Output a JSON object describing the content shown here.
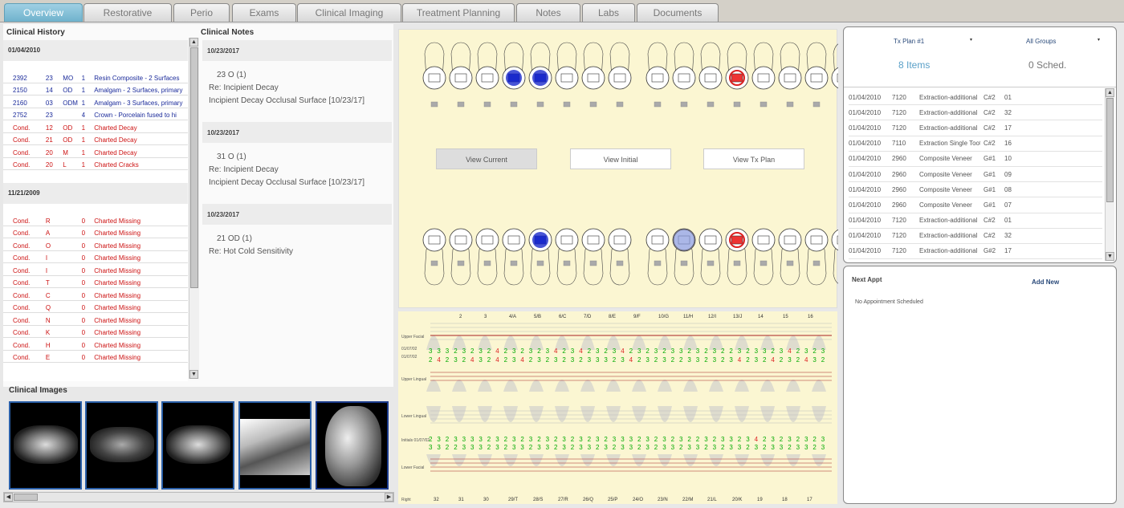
{
  "tabs": [
    "Overview",
    "Restorative",
    "Perio",
    "Exams",
    "Clinical Imaging",
    "Treatment Planning",
    "Notes",
    "Labs",
    "Documents"
  ],
  "clinical_history": {
    "title": "Clinical History",
    "groups": [
      {
        "date": "01/04/2010",
        "rows": [
          {
            "c": "blue",
            "f": [
              "2392",
              "23",
              "MO",
              "1",
              "Resin Composite - 2 Surfaces"
            ]
          },
          {
            "c": "blue",
            "f": [
              "2150",
              "14",
              "OD",
              "1",
              "Amalgam - 2 Surfaces, primary"
            ]
          },
          {
            "c": "blue",
            "f": [
              "2160",
              "03",
              "ODM",
              "1",
              "Amalgam - 3 Surfaces, primary"
            ]
          },
          {
            "c": "blue",
            "f": [
              "2752",
              "23",
              "",
              "4",
              "Crown - Porcelain fused to hi"
            ]
          },
          {
            "c": "red",
            "f": [
              "Cond.",
              "12",
              "OD",
              "1",
              "Charted Decay"
            ]
          },
          {
            "c": "red",
            "f": [
              "Cond.",
              "21",
              "OD",
              "1",
              "Charted Decay"
            ]
          },
          {
            "c": "red",
            "f": [
              "Cond.",
              "20",
              "M",
              "1",
              "Charted Decay"
            ]
          },
          {
            "c": "red",
            "f": [
              "Cond.",
              "20",
              "L",
              "1",
              "Charted Cracks"
            ]
          }
        ]
      },
      {
        "date": "11/21/2009",
        "rows": [
          {
            "c": "red",
            "f": [
              "Cond.",
              "R",
              "",
              "0",
              "Charted Missing"
            ]
          },
          {
            "c": "red",
            "f": [
              "Cond.",
              "A",
              "",
              "0",
              "Charted Missing"
            ]
          },
          {
            "c": "red",
            "f": [
              "Cond.",
              "O",
              "",
              "0",
              "Charted Missing"
            ]
          },
          {
            "c": "red",
            "f": [
              "Cond.",
              "I",
              "",
              "0",
              "Charted Missing"
            ]
          },
          {
            "c": "red",
            "f": [
              "Cond.",
              "I",
              "",
              "0",
              "Charted Missing"
            ]
          },
          {
            "c": "red",
            "f": [
              "Cond.",
              "T",
              "",
              "0",
              "Charted Missing"
            ]
          },
          {
            "c": "red",
            "f": [
              "Cond.",
              "C",
              "",
              "0",
              "Charted Missing"
            ]
          },
          {
            "c": "red",
            "f": [
              "Cond.",
              "Q",
              "",
              "0",
              "Charted Missing"
            ]
          },
          {
            "c": "red",
            "f": [
              "Cond.",
              "N",
              "",
              "0",
              "Charted Missing"
            ]
          },
          {
            "c": "red",
            "f": [
              "Cond.",
              "K",
              "",
              "0",
              "Charted Missing"
            ]
          },
          {
            "c": "red",
            "f": [
              "Cond.",
              "H",
              "",
              "0",
              "Charted Missing"
            ]
          },
          {
            "c": "red",
            "f": [
              "Cond.",
              "E",
              "",
              "0",
              "Charted Missing"
            ]
          }
        ]
      }
    ]
  },
  "clinical_notes": {
    "title": "Clinical Notes",
    "notes": [
      {
        "date": "10/23/2017",
        "lines": [
          "23   O   (1)",
          "Re: Incipient Decay",
          "Incipient Decay Occlusal Surface [10/23/17]"
        ]
      },
      {
        "date": "10/23/2017",
        "lines": [
          "31   O   (1)",
          "Re: Incipient Decay",
          "Incipient Decay Occlusal Surface [10/23/17]"
        ]
      },
      {
        "date": "10/23/2017",
        "lines": [
          "21   OD   (1)",
          "Re: Hot  Cold Sensitivity"
        ]
      }
    ]
  },
  "clinical_images": {
    "title": "Clinical Images"
  },
  "chart_buttons": [
    "View Current",
    "View Initial",
    "View Tx Plan"
  ],
  "perio": {
    "upper_teeth": [
      "2",
      "3",
      "4/A",
      "5/B",
      "6/C",
      "7/D",
      "8/E",
      "9/F",
      "10/G",
      "11/H",
      "12/I",
      "13/J",
      "14",
      "15",
      "16"
    ],
    "lower_teeth": [
      "32",
      "31",
      "30",
      "29/T",
      "28/S",
      "27/R",
      "26/Q",
      "25/P",
      "24/O",
      "23/N",
      "22/M",
      "21/L",
      "20/K",
      "19",
      "18",
      "17"
    ],
    "labels": [
      "Upper Facial",
      "01/07/02",
      "01/07/02",
      "Upper Lingual",
      "Lower Lingual",
      "Initials 01/07/02",
      "Lower Facial",
      "Right"
    ],
    "row1": "3 3 3 2 3 2 3 2 4 2 3 2 3 2 3 4 2 3 4 2 3 2 3 4 2 3 2 3 2 3 3 2 3 2 3 2 2 3 2 3 3 2 3 4 2 3 2 3",
    "row2": "2 4 2 3 2 4 3 2 4 2 3 4 2 3 2 3 2 3 2 3 3 3 2 3 4 2 3 2 3 2 2 3 3 2 3 2 3 4 2 3 2 4 2 3 2 4 3 2",
    "row3": "2 3 2 3 3 3 3 2 3 2 3 2 3 2 3 2 3 2 3 2 3 2 3 3 3 2 3 2 3 2 3 2 2 3 2 3 3 2 3 4 2 3 2 3 2 3 2 3",
    "row4": "3 3 2 2 3 3 3 2 3 2 3 3 2 3 3 2 3 2 3 3 2 3 2 3 3 2 3 2 3 3 2 3 3 2 3 2 3 3 2 3 2 3 3 2 3 3 2 3"
  },
  "tx_plan": {
    "plan": "Tx Plan #1",
    "groups": "All Groups",
    "items": "8 Items",
    "sched": "0 Sched.",
    "rows": [
      [
        "01/04/2010",
        "7120",
        "Extraction-additional",
        "C#2",
        "01"
      ],
      [
        "01/04/2010",
        "7120",
        "Extraction-additional",
        "C#2",
        "32"
      ],
      [
        "01/04/2010",
        "7120",
        "Extraction-additional",
        "C#2",
        "17"
      ],
      [
        "01/04/2010",
        "7110",
        "Extraction Single Tooth",
        "C#2",
        "16"
      ],
      [
        "01/04/2010",
        "2960",
        "Composite Veneer",
        "G#1",
        "10"
      ],
      [
        "01/04/2010",
        "2960",
        "Composite Veneer",
        "G#1",
        "09"
      ],
      [
        "01/04/2010",
        "2960",
        "Composite Veneer",
        "G#1",
        "08"
      ],
      [
        "01/04/2010",
        "2960",
        "Composite Veneer",
        "G#1",
        "07"
      ],
      [
        "01/04/2010",
        "7120",
        "Extraction-additional",
        "C#2",
        "01"
      ],
      [
        "01/04/2010",
        "7120",
        "Extraction-additional",
        "C#2",
        "32"
      ],
      [
        "01/04/2010",
        "7120",
        "Extraction-additional",
        "G#2",
        "17"
      ]
    ]
  },
  "next_appt": {
    "title": "Next Appt",
    "add": "Add New",
    "empty": "No Appointment Scheduled"
  }
}
